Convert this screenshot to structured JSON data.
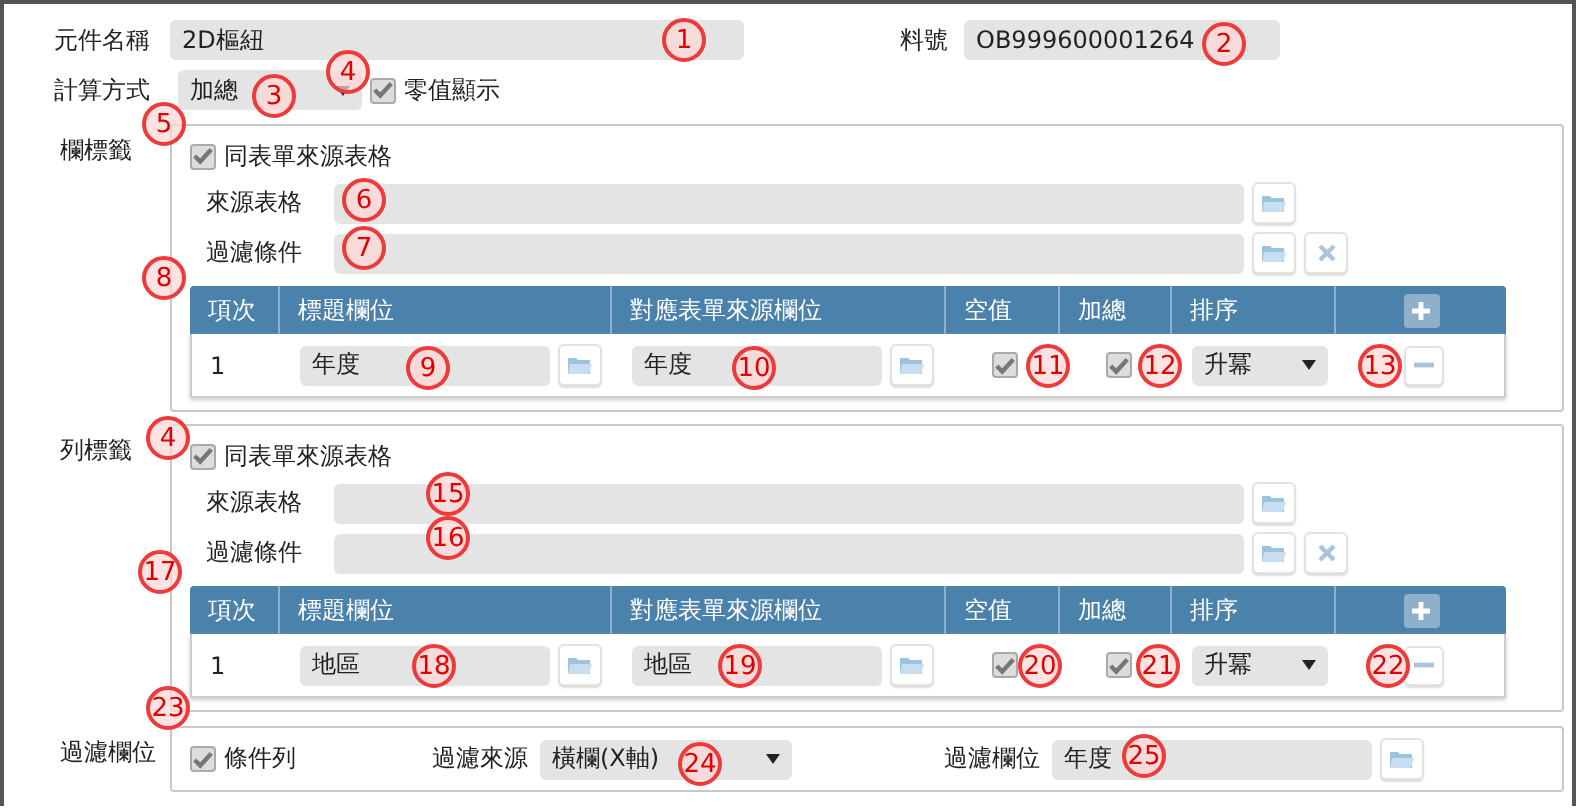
{
  "component_name": {
    "label": "元件名稱",
    "value": "2D樞紐"
  },
  "part_number": {
    "label": "料號",
    "value": "OB999600001264"
  },
  "calc_method": {
    "label": "計算方式",
    "value": "加總"
  },
  "zero_display": {
    "label": "零值顯示",
    "checked": true
  },
  "sections": [
    {
      "label": "欄標籤",
      "same_source": {
        "label": "同表單來源表格",
        "checked": true
      },
      "source_table": {
        "label": "來源表格"
      },
      "filter": {
        "label": "過濾條件"
      },
      "columns": [
        "項次",
        "標題欄位",
        "對應表單來源欄位",
        "空值",
        "加總",
        "排序"
      ],
      "rows": [
        {
          "index": "1",
          "title_field": "年度",
          "source_field": "年度",
          "empty_value": true,
          "sum": true,
          "sort": "升冪"
        }
      ]
    },
    {
      "label": "列標籤",
      "same_source": {
        "label": "同表單來源表格",
        "checked": true
      },
      "source_table": {
        "label": "來源表格"
      },
      "filter": {
        "label": "過濾條件"
      },
      "columns": [
        "項次",
        "標題欄位",
        "對應表單來源欄位",
        "空值",
        "加總",
        "排序"
      ],
      "rows": [
        {
          "index": "1",
          "title_field": "地區",
          "source_field": "地區",
          "empty_value": true,
          "sum": true,
          "sort": "升冪"
        }
      ]
    }
  ],
  "filter_field": {
    "label": "過濾欄位",
    "condition_row": {
      "label": "條件列",
      "checked": true
    },
    "filter_source": {
      "label": "過濾來源",
      "value": "橫欄(X軸)"
    },
    "filter_column": {
      "label": "過濾欄位",
      "value": "年度"
    }
  },
  "annotations": [
    "1",
    "2",
    "3",
    "4",
    "5",
    "6",
    "7",
    "8",
    "9",
    "10",
    "11",
    "12",
    "13",
    "4",
    "15",
    "16",
    "17",
    "18",
    "19",
    "20",
    "21",
    "22",
    "23",
    "24",
    "25"
  ]
}
